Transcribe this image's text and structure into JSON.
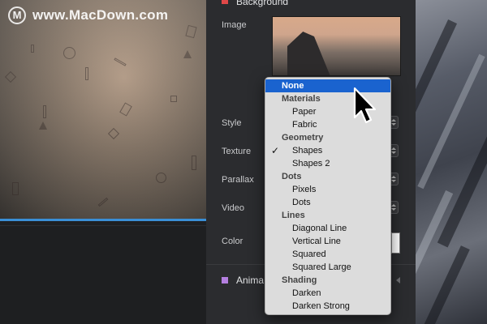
{
  "watermark": {
    "text": "www.MacDown.com",
    "logo_letter": "M"
  },
  "panel": {
    "background_title": "Background",
    "animation_title": "Anima",
    "labels": {
      "image": "Image",
      "style": "Style",
      "texture": "Texture",
      "parallax": "Parallax",
      "video": "Video",
      "color": "Color"
    },
    "color_value": "#ffffff"
  },
  "menu": {
    "items": [
      {
        "label": "None",
        "type": "selected"
      },
      {
        "label": "Materials",
        "type": "header"
      },
      {
        "label": "Paper",
        "type": "item"
      },
      {
        "label": "Fabric",
        "type": "item"
      },
      {
        "label": "Geometry",
        "type": "header"
      },
      {
        "label": "Shapes",
        "type": "item",
        "checked": true
      },
      {
        "label": "Shapes 2",
        "type": "item"
      },
      {
        "label": "Dots",
        "type": "header"
      },
      {
        "label": "Pixels",
        "type": "item"
      },
      {
        "label": "Dots",
        "type": "item"
      },
      {
        "label": "Lines",
        "type": "header"
      },
      {
        "label": "Diagonal Line",
        "type": "item"
      },
      {
        "label": "Vertical Line",
        "type": "item"
      },
      {
        "label": "Squared",
        "type": "item"
      },
      {
        "label": "Squared Large",
        "type": "item"
      },
      {
        "label": "Shading",
        "type": "header"
      },
      {
        "label": "Darken",
        "type": "item"
      },
      {
        "label": "Darken Strong",
        "type": "item"
      }
    ],
    "checkmark": "✓"
  },
  "colors": {
    "accent": "#1a63cf",
    "background_square": "#e04848",
    "animation_square": "#b47fe0",
    "timeline": "#3a8fd6"
  }
}
